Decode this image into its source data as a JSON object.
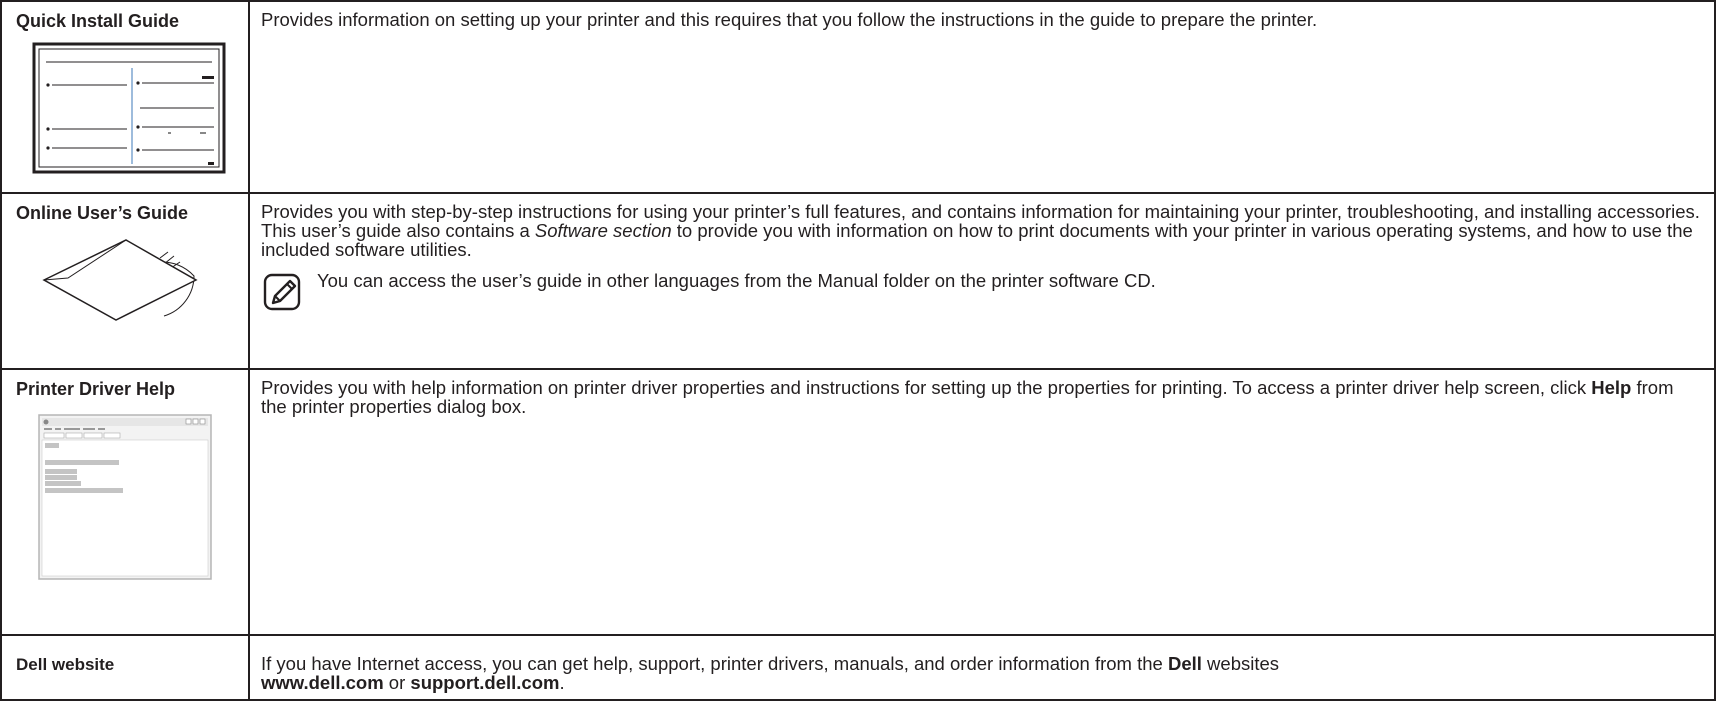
{
  "rows": [
    {
      "name": "Quick Install Guide",
      "icon": "quick-install-guide-thumbnail-icon",
      "desc": "Provides information on setting up your printer and this requires that you follow the instructions in the guide to prepare the printer."
    },
    {
      "name": "Online User’s Guide",
      "icon": "cd-sleeve-icon",
      "desc1": "Provides you with step-by-step instructions for using your printer’s full features, and contains information for maintaining your printer, troubleshooting, and installing accessories.",
      "desc2_pre": "This user’s guide also contains a ",
      "desc2_em": "Software section",
      "desc2_post": " to provide you with information on how to print documents with your printer in various operating systems, and how to use the included software utilities.",
      "note_icon": "note-icon",
      "note": "You can access the user’s guide in other languages from the Manual folder on the printer software CD."
    },
    {
      "name": "Printer Driver Help",
      "icon": "help-window-screenshot-icon",
      "desc_pre": "Provides you with help information on printer driver properties and instructions for setting up the properties for printing. To access a printer driver help screen, click ",
      "desc_bold": "Help",
      "desc_post": " from the printer properties dialog box."
    },
    {
      "name": "Dell website",
      "desc_pre": "If you have Internet access, you can get help, support, printer drivers, manuals, and order information from the ",
      "desc_bold1": "Dell",
      "desc_mid": " websites ",
      "desc_bold2": "www.dell.com",
      "desc_or": " or ",
      "desc_bold3": "support.dell.com",
      "desc_end": "."
    }
  ]
}
